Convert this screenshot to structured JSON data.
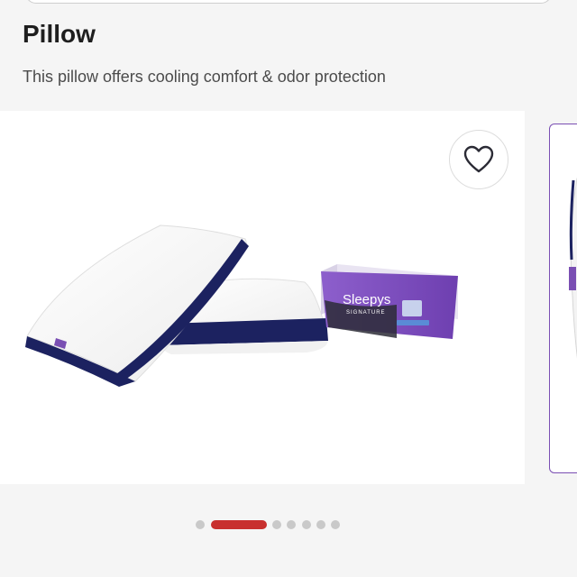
{
  "product": {
    "title": "Pillow",
    "subtitle": "This pillow offers cooling comfort & odor protection",
    "box_brand": "Sleepys",
    "box_line": "SIGNATURE"
  },
  "gallery": {
    "favorite_icon": "heart-outline-icon",
    "slide_count": 7,
    "active_slide": 2
  },
  "colors": {
    "accent_red": "#c8302e",
    "brand_purple": "#7a4fb3",
    "pillow_trim_navy": "#1c2260"
  }
}
